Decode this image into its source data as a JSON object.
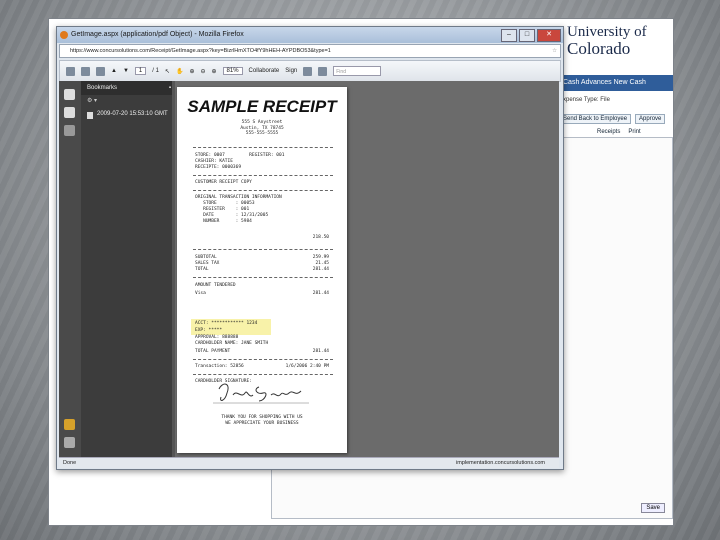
{
  "browser": {
    "title": "GetImage.aspx (application/pdf Object) - Mozilla Firefox",
    "url": "https://www.concursolutions.com/Receipt/GetImage.aspx?key=BizrlHmXTO4fY9hHEH-AYPDBO53&type=1",
    "status_left": "Done",
    "status_right": "implementation.concursolutions.com"
  },
  "pdf_toolbar": {
    "page_current": "1",
    "page_total": "/ 1",
    "zoom": "81%",
    "collaborate": "Collaborate",
    "sign": "Sign",
    "find_placeholder": "Find"
  },
  "bookmarks": {
    "header": "Bookmarks",
    "item": "2009-07-20 15:53:10 GMT"
  },
  "receipt": {
    "title": "SAMPLE RECEIPT",
    "address": [
      "555 S Anystreet",
      "Austin, TX 78745",
      "555-555-5555"
    ],
    "store_line": "STORE: 0007         REGISTER: 001",
    "cashier_line": "CASHIER: KATIE",
    "receipt_line": "RECEIPTE: 0000369",
    "customer_copy": "CUSTOMER RECEIPT COPY",
    "orig_info": "ORIGINAL TRANSACTION INFORMATION",
    "orig_store": "   STORE       : 00053",
    "orig_register": "   REGISTER    : 001",
    "orig_date": "   DATE        : 12/31/2005",
    "orig_number": "   NUMBER      : 5984",
    "amount_1": "218.50",
    "subtotal_label": "SUBTOTAL",
    "subtotal": "259.99",
    "tax_label": "SALES TAX",
    "tax": "21.45",
    "total_label": "TOTAL",
    "total": "281.44",
    "tendered": "AMOUNT TENDERED",
    "visa_label": "Visa",
    "visa": "281.44",
    "acct": "ACCT: ************ 1234",
    "exp": "EXP: *****",
    "approval": "APPROVAL: 888888",
    "cardholder": "CARDHOLDER NAME: JANE SMITH",
    "total_payment_label": "TOTAL PAYMENT",
    "total_payment": "281.44",
    "transaction": "Transaction: 52856",
    "trans_date": "1/6/2006 2:40 PM",
    "sig_label": "CARDHOLDER SIGNATURE:",
    "signature": "Jane Smith",
    "thanks": [
      "THANK YOU FOR SHOPPING WITH US",
      "WE APPRECIATE YOUR BUSINESS"
    ]
  },
  "background_app": {
    "logo_line1": "University of",
    "logo_line2": "Colorado",
    "nav": "Cash Advances   New Cash Advance",
    "expense_type": "Expense Type:  File",
    "send_back": "Send Back to Employee",
    "approve": "Approve",
    "receipts": "Receipts",
    "print": "Print",
    "save": "Save"
  },
  "colors": {
    "highlight": "#f7f09a",
    "nav_blue": "#2f5d9a"
  }
}
